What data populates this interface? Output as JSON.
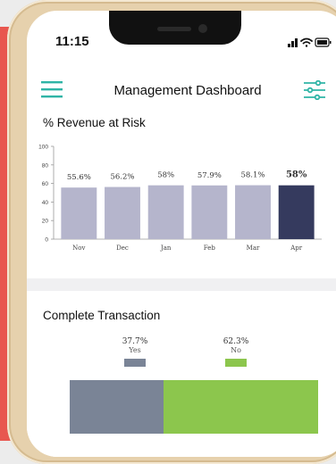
{
  "status": {
    "time": "11:15"
  },
  "header": {
    "title": "Management Dashboard"
  },
  "revenue_chart": {
    "title": "% Revenue at Risk"
  },
  "transactions": {
    "title": "Complete Transaction",
    "yes": {
      "pct": "37.7%",
      "label": "Yes",
      "value": 37.7,
      "color": "#7a8496"
    },
    "no": {
      "pct": "62.3%",
      "label": "No",
      "value": 62.3,
      "color": "#8cc64d"
    }
  },
  "colors": {
    "bar": "#b5b5cc",
    "bar_highlight": "#353a5e",
    "accent": "#2fb4a6",
    "side": "#e8574f"
  },
  "chart_data": {
    "type": "bar",
    "title": "% Revenue at Risk",
    "categories": [
      "Nov",
      "Dec",
      "Jan",
      "Feb",
      "Mar",
      "Apr"
    ],
    "values": [
      55.6,
      56.2,
      58,
      57.9,
      58.1,
      58
    ],
    "data_labels": [
      "55.6%",
      "56.2%",
      "58%",
      "57.9%",
      "58.1%",
      "58%"
    ],
    "yticks": [
      0,
      20,
      40,
      60,
      80,
      100
    ],
    "ylim": [
      0,
      100
    ],
    "highlight": "Apr",
    "grid": false
  }
}
